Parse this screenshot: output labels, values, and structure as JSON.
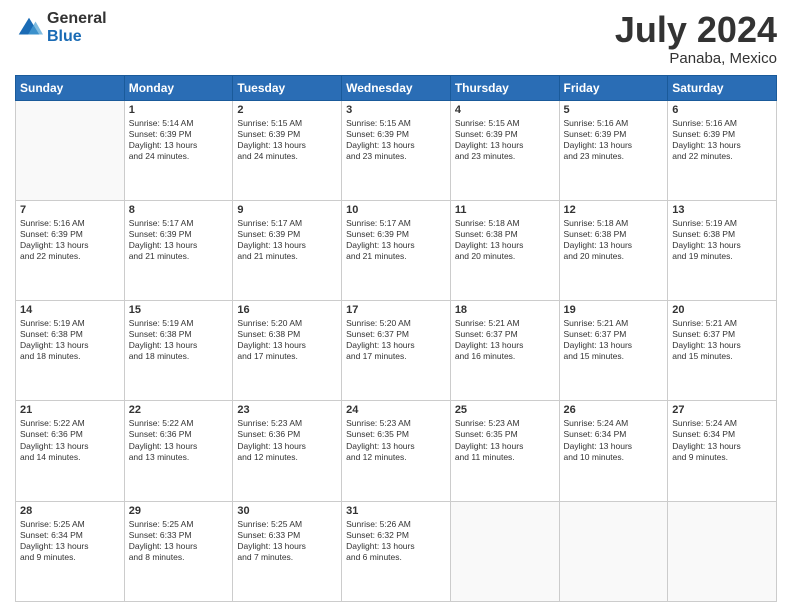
{
  "logo": {
    "general": "General",
    "blue": "Blue"
  },
  "header": {
    "month_year": "July 2024",
    "location": "Panaba, Mexico"
  },
  "days_of_week": [
    "Sunday",
    "Monday",
    "Tuesday",
    "Wednesday",
    "Thursday",
    "Friday",
    "Saturday"
  ],
  "weeks": [
    [
      {
        "day": "",
        "content": ""
      },
      {
        "day": "1",
        "content": "Sunrise: 5:14 AM\nSunset: 6:39 PM\nDaylight: 13 hours\nand 24 minutes."
      },
      {
        "day": "2",
        "content": "Sunrise: 5:15 AM\nSunset: 6:39 PM\nDaylight: 13 hours\nand 24 minutes."
      },
      {
        "day": "3",
        "content": "Sunrise: 5:15 AM\nSunset: 6:39 PM\nDaylight: 13 hours\nand 23 minutes."
      },
      {
        "day": "4",
        "content": "Sunrise: 5:15 AM\nSunset: 6:39 PM\nDaylight: 13 hours\nand 23 minutes."
      },
      {
        "day": "5",
        "content": "Sunrise: 5:16 AM\nSunset: 6:39 PM\nDaylight: 13 hours\nand 23 minutes."
      },
      {
        "day": "6",
        "content": "Sunrise: 5:16 AM\nSunset: 6:39 PM\nDaylight: 13 hours\nand 22 minutes."
      }
    ],
    [
      {
        "day": "7",
        "content": "Sunrise: 5:16 AM\nSunset: 6:39 PM\nDaylight: 13 hours\nand 22 minutes."
      },
      {
        "day": "8",
        "content": "Sunrise: 5:17 AM\nSunset: 6:39 PM\nDaylight: 13 hours\nand 21 minutes."
      },
      {
        "day": "9",
        "content": "Sunrise: 5:17 AM\nSunset: 6:39 PM\nDaylight: 13 hours\nand 21 minutes."
      },
      {
        "day": "10",
        "content": "Sunrise: 5:17 AM\nSunset: 6:39 PM\nDaylight: 13 hours\nand 21 minutes."
      },
      {
        "day": "11",
        "content": "Sunrise: 5:18 AM\nSunset: 6:38 PM\nDaylight: 13 hours\nand 20 minutes."
      },
      {
        "day": "12",
        "content": "Sunrise: 5:18 AM\nSunset: 6:38 PM\nDaylight: 13 hours\nand 20 minutes."
      },
      {
        "day": "13",
        "content": "Sunrise: 5:19 AM\nSunset: 6:38 PM\nDaylight: 13 hours\nand 19 minutes."
      }
    ],
    [
      {
        "day": "14",
        "content": "Sunrise: 5:19 AM\nSunset: 6:38 PM\nDaylight: 13 hours\nand 18 minutes."
      },
      {
        "day": "15",
        "content": "Sunrise: 5:19 AM\nSunset: 6:38 PM\nDaylight: 13 hours\nand 18 minutes."
      },
      {
        "day": "16",
        "content": "Sunrise: 5:20 AM\nSunset: 6:38 PM\nDaylight: 13 hours\nand 17 minutes."
      },
      {
        "day": "17",
        "content": "Sunrise: 5:20 AM\nSunset: 6:37 PM\nDaylight: 13 hours\nand 17 minutes."
      },
      {
        "day": "18",
        "content": "Sunrise: 5:21 AM\nSunset: 6:37 PM\nDaylight: 13 hours\nand 16 minutes."
      },
      {
        "day": "19",
        "content": "Sunrise: 5:21 AM\nSunset: 6:37 PM\nDaylight: 13 hours\nand 15 minutes."
      },
      {
        "day": "20",
        "content": "Sunrise: 5:21 AM\nSunset: 6:37 PM\nDaylight: 13 hours\nand 15 minutes."
      }
    ],
    [
      {
        "day": "21",
        "content": "Sunrise: 5:22 AM\nSunset: 6:36 PM\nDaylight: 13 hours\nand 14 minutes."
      },
      {
        "day": "22",
        "content": "Sunrise: 5:22 AM\nSunset: 6:36 PM\nDaylight: 13 hours\nand 13 minutes."
      },
      {
        "day": "23",
        "content": "Sunrise: 5:23 AM\nSunset: 6:36 PM\nDaylight: 13 hours\nand 12 minutes."
      },
      {
        "day": "24",
        "content": "Sunrise: 5:23 AM\nSunset: 6:35 PM\nDaylight: 13 hours\nand 12 minutes."
      },
      {
        "day": "25",
        "content": "Sunrise: 5:23 AM\nSunset: 6:35 PM\nDaylight: 13 hours\nand 11 minutes."
      },
      {
        "day": "26",
        "content": "Sunrise: 5:24 AM\nSunset: 6:34 PM\nDaylight: 13 hours\nand 10 minutes."
      },
      {
        "day": "27",
        "content": "Sunrise: 5:24 AM\nSunset: 6:34 PM\nDaylight: 13 hours\nand 9 minutes."
      }
    ],
    [
      {
        "day": "28",
        "content": "Sunrise: 5:25 AM\nSunset: 6:34 PM\nDaylight: 13 hours\nand 9 minutes."
      },
      {
        "day": "29",
        "content": "Sunrise: 5:25 AM\nSunset: 6:33 PM\nDaylight: 13 hours\nand 8 minutes."
      },
      {
        "day": "30",
        "content": "Sunrise: 5:25 AM\nSunset: 6:33 PM\nDaylight: 13 hours\nand 7 minutes."
      },
      {
        "day": "31",
        "content": "Sunrise: 5:26 AM\nSunset: 6:32 PM\nDaylight: 13 hours\nand 6 minutes."
      },
      {
        "day": "",
        "content": ""
      },
      {
        "day": "",
        "content": ""
      },
      {
        "day": "",
        "content": ""
      }
    ]
  ]
}
